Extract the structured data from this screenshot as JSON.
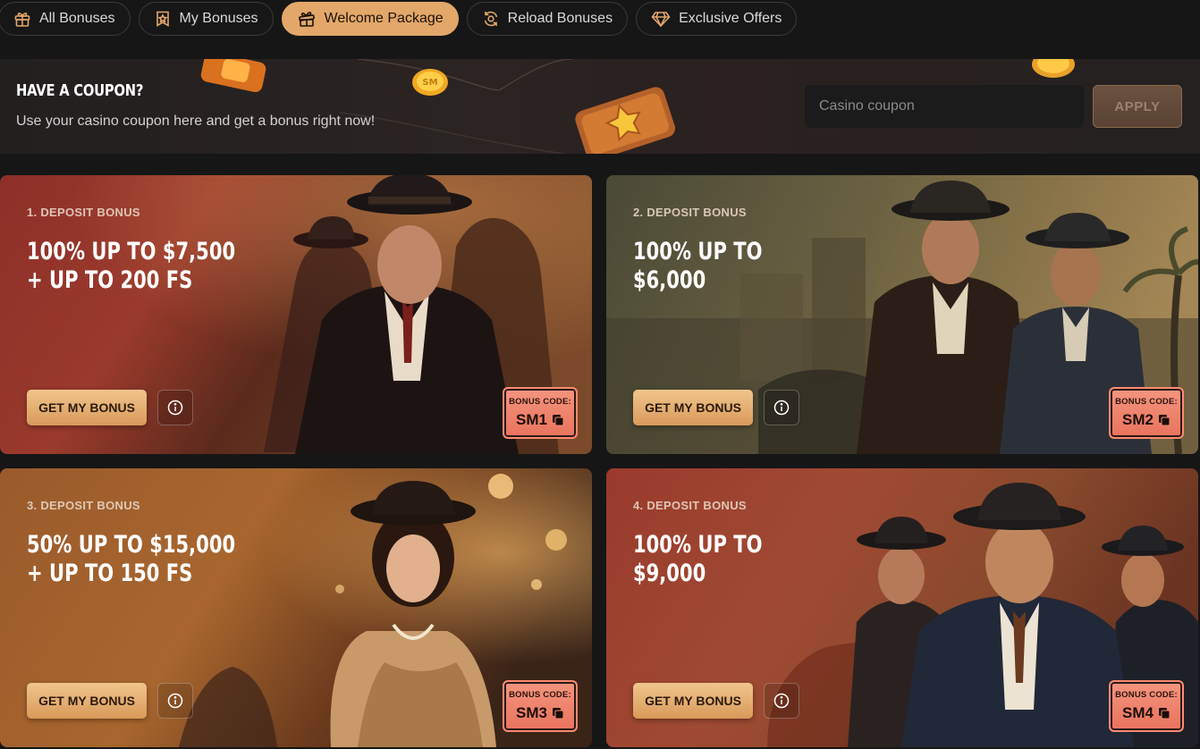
{
  "tabs": [
    {
      "label": "All Bonuses",
      "icon": "gift-icon",
      "active": false
    },
    {
      "label": "My Bonuses",
      "icon": "badge-star-icon",
      "active": false
    },
    {
      "label": "Welcome Package",
      "icon": "gift-open-icon",
      "active": true
    },
    {
      "label": "Reload Bonuses",
      "icon": "reload-icon",
      "active": false
    },
    {
      "label": "Exclusive Offers",
      "icon": "diamond-icon",
      "active": false
    }
  ],
  "coupon": {
    "title": "HAVE A COUPON?",
    "description": "Use your casino coupon here and get a bonus right now!",
    "input_placeholder": "Casino coupon",
    "input_value": "",
    "apply_label": "APPLY"
  },
  "cards": [
    {
      "label": "1. DEPOSIT BONUS",
      "line1": "100% UP TO $7,500",
      "line2": "+ UP TO 200 FS",
      "button": "GET MY BONUS",
      "code_title": "BONUS CODE:",
      "code": "SM1"
    },
    {
      "label": "2. DEPOSIT BONUS",
      "line1": "100% UP TO",
      "line2": "$6,000",
      "button": "GET MY BONUS",
      "code_title": "BONUS CODE:",
      "code": "SM2"
    },
    {
      "label": "3. DEPOSIT BONUS",
      "line1": "50% UP TO $15,000",
      "line2": "+ UP TO 150 FS",
      "button": "GET MY BONUS",
      "code_title": "BONUS CODE:",
      "code": "SM3"
    },
    {
      "label": "4. DEPOSIT BONUS",
      "line1": "100% UP TO",
      "line2": "$9,000",
      "button": "GET MY BONUS",
      "code_title": "BONUS CODE:",
      "code": "SM4"
    }
  ],
  "colors": {
    "accent": "#e3a76a",
    "code_badge": "#f08a72",
    "background": "#161616"
  }
}
